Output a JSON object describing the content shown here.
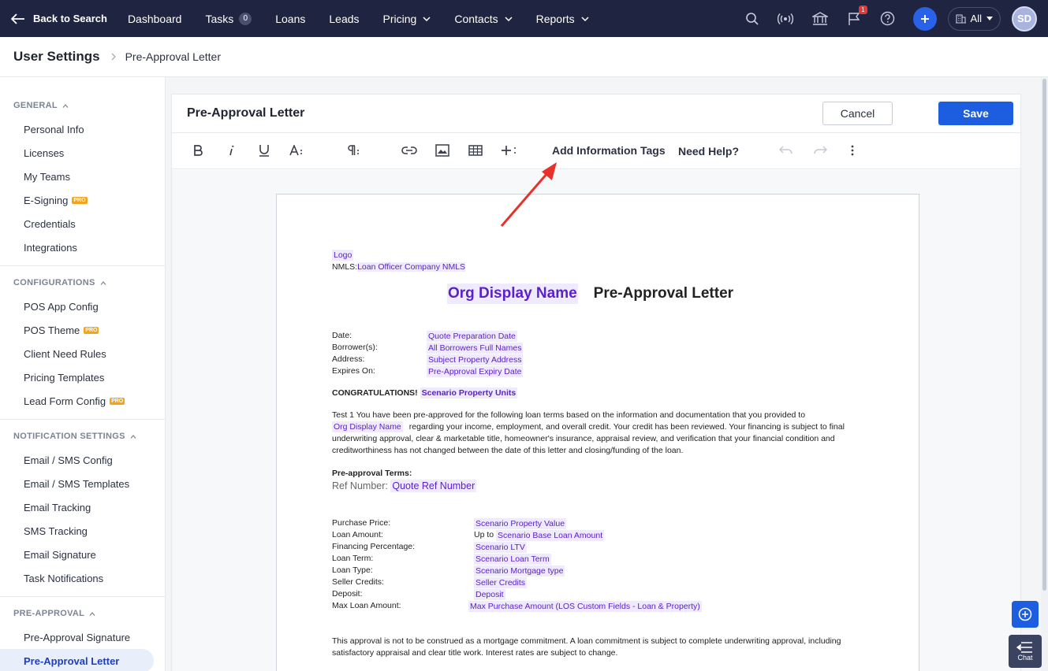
{
  "topnav": {
    "back_label": "Back to Search",
    "items": [
      {
        "label": "Dashboard"
      },
      {
        "label": "Tasks",
        "badge": "0"
      },
      {
        "label": "Loans"
      },
      {
        "label": "Leads"
      },
      {
        "label": "Pricing",
        "dropdown": true
      },
      {
        "label": "Contacts",
        "dropdown": true
      },
      {
        "label": "Reports",
        "dropdown": true
      }
    ],
    "notif_count": "1",
    "scope_label": "All",
    "avatar_initials": "SD",
    "icons": [
      "search-icon",
      "broadcast-icon",
      "bank-icon",
      "flag-icon",
      "help-icon",
      "plus-icon",
      "building-icon"
    ]
  },
  "breadcrumb": {
    "root": "User Settings",
    "current": "Pre-Approval Letter"
  },
  "sidebar": {
    "sections": [
      {
        "title": "GENERAL",
        "items": [
          {
            "label": "Personal Info"
          },
          {
            "label": "Licenses"
          },
          {
            "label": "My Teams"
          },
          {
            "label": "E-Signing",
            "pro": "PRO"
          },
          {
            "label": "Credentials"
          },
          {
            "label": "Integrations"
          }
        ]
      },
      {
        "title": "CONFIGURATIONS",
        "items": [
          {
            "label": "POS App Config"
          },
          {
            "label": "POS Theme",
            "pro": "PRO"
          },
          {
            "label": "Client Need Rules"
          },
          {
            "label": "Pricing Templates"
          },
          {
            "label": "Lead Form Config",
            "pro": "PRO"
          }
        ]
      },
      {
        "title": "NOTIFICATION SETTINGS",
        "items": [
          {
            "label": "Email / SMS Config"
          },
          {
            "label": "Email / SMS Templates"
          },
          {
            "label": "Email Tracking"
          },
          {
            "label": "SMS Tracking"
          },
          {
            "label": "Email Signature"
          },
          {
            "label": "Task Notifications"
          }
        ]
      },
      {
        "title": "PRE-APPROVAL",
        "items": [
          {
            "label": "Pre-Approval Signature"
          },
          {
            "label": "Pre-Approval Letter",
            "active": true
          }
        ]
      }
    ]
  },
  "card": {
    "title": "Pre-Approval Letter",
    "cancel_label": "Cancel",
    "save_label": "Save"
  },
  "toolbar": {
    "add_tags_label": "Add Information Tags",
    "help_label": "Need Help?",
    "icons": [
      "bold-icon",
      "italic-icon",
      "underline-icon",
      "font-size-icon",
      "paragraph-icon",
      "link-icon",
      "image-icon",
      "table-icon",
      "insert-icon",
      "undo-icon",
      "redo-icon",
      "more-icon"
    ]
  },
  "doc": {
    "logo_tag": "Logo",
    "nmls_label": "NMLS:",
    "nmls_tag": "Loan Officer Company NMLS",
    "org_tag": "Org Display Name",
    "heading": "Pre-Approval Letter",
    "info_rows": [
      {
        "k": "Date:",
        "v": "Quote Preparation Date"
      },
      {
        "k": "Borrower(s):",
        "v": "All Borrowers Full Names"
      },
      {
        "k": "Address:",
        "v": "Subject Property Address"
      },
      {
        "k": "Expires On:",
        "v": "Pre-Approval Expiry Date"
      }
    ],
    "congrats": "CONGRATULATIONS!",
    "congrats_tag": "Scenario Property Units",
    "para1_a": "Test 1 You have been pre-approved for the following loan terms based on the information and  documentation that you provided to",
    "para1_tag": "Org Display Name",
    "para1_b": "regarding your income, employment, and overall credit. Your credit has  been reviewed. Your financing is subject to final",
    "para1_c": "underwriting approval, clear & marketable title, homeowner's  insurance, appraisal review, and verification that your financial condition and",
    "para1_d": "creditworthiness has not changed  between the date of this letter and closing/funding of the loan.",
    "terms_heading": "Pre-approval Terms:",
    "ref_label": "Ref Number:",
    "ref_tag": "Quote Ref Number",
    "term_rows": [
      {
        "k": "Purchase Price:",
        "pre": "",
        "v": "Scenario Property Value"
      },
      {
        "k": "Loan Amount:",
        "pre": "Up to ",
        "v": "Scenario Base Loan Amount"
      },
      {
        "k": "Financing Percentage:",
        "pre": "",
        "v": "Scenario LTV"
      },
      {
        "k": "Loan Term:",
        "pre": "",
        "v": "Scenario Loan Term"
      },
      {
        "k": "Loan Type:",
        "pre": "",
        "v": "Scenario Mortgage type"
      },
      {
        "k": "Seller Credits:",
        "pre": "",
        "v": "Seller Credits"
      },
      {
        "k": "Deposit:",
        "pre": "",
        "v": "Deposit"
      },
      {
        "k": "Max Loan Amount:",
        "pre": "",
        "v": "Max Purchase Amount (LOS Custom Fields - Loan & Property)"
      }
    ],
    "footer_a": "This approval is not to be construed as a mortgage commitment. A loan commitment is subject to  complete underwriting approval, including",
    "footer_b": "satisfactory appraisal and clear title work. Interest rates are subject  to change."
  },
  "chat": {
    "label": "Chat"
  },
  "colors": {
    "nav_bg": "#1f2440",
    "accent": "#1d5ee0",
    "tag_text": "#5b21c9",
    "tag_bg": "#f0eaff",
    "annotation_arrow": "#e8312a"
  }
}
